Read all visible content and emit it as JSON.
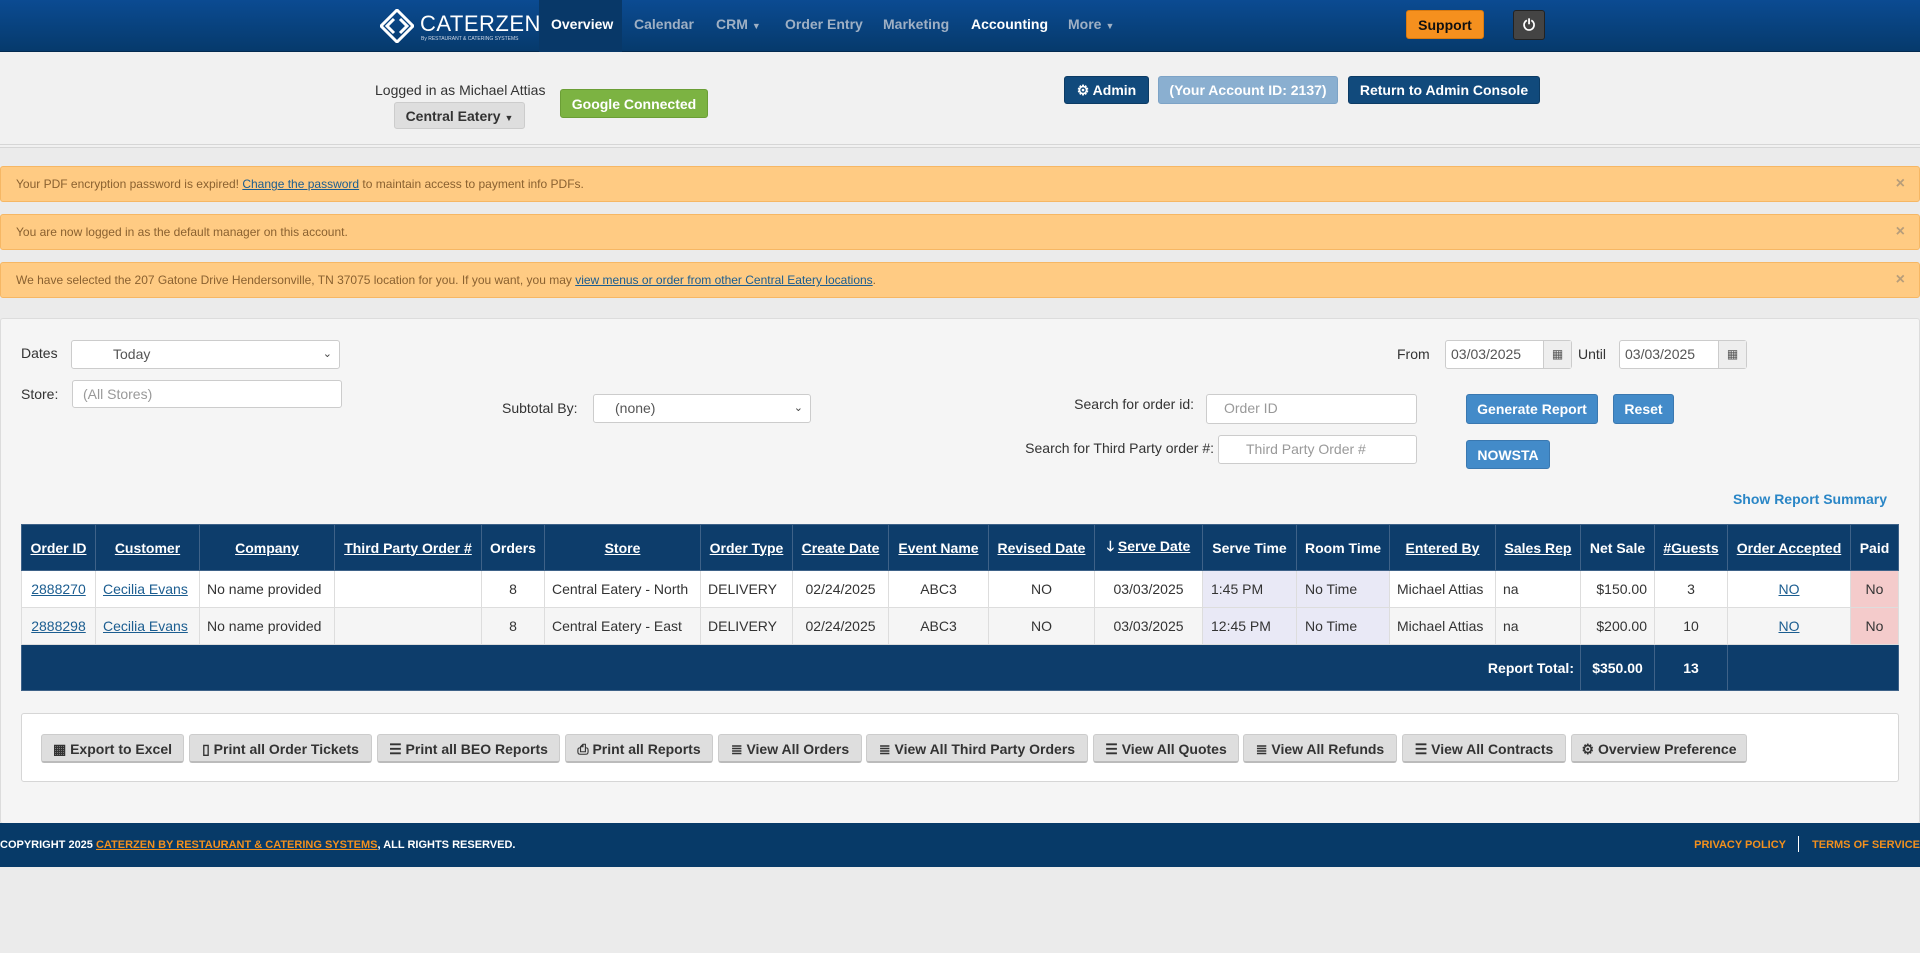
{
  "nav": {
    "brand": "CATERZEN",
    "brand_sub": "By RESTAURANT & CATERING SYSTEMS",
    "items": [
      {
        "label": "Overview"
      },
      {
        "label": "Calendar"
      },
      {
        "label": "CRM"
      },
      {
        "label": "Order Entry"
      },
      {
        "label": "Marketing"
      },
      {
        "label": "Accounting"
      },
      {
        "label": "More"
      }
    ],
    "support": "Support"
  },
  "header": {
    "logged_in": "Logged in as Michael Attias",
    "store_button": "Central Eatery",
    "google": "Google Connected",
    "admin": "Admin",
    "account_id": "(Your Account ID: 2137)",
    "return": "Return to Admin Console"
  },
  "alerts": [
    {
      "pre": "Your PDF encryption password is expired! ",
      "link": "Change the password",
      "post": " to maintain access to payment info PDFs."
    },
    {
      "pre": "You are now logged in as the default manager on this account.",
      "link": "",
      "post": ""
    },
    {
      "pre": "We have selected the 207 Gatone Drive Hendersonville, TN 37075 location for you. If you want, you may ",
      "link": "view menus or order from other Central Eatery locations",
      "post": "."
    }
  ],
  "filters": {
    "dates_label": "Dates",
    "dates_value": "Today",
    "store_label": "Store:",
    "store_placeholder": "(All Stores)",
    "subtotal_label": "Subtotal By:",
    "subtotal_value": "(none)",
    "from_label": "From",
    "from_value": "03/03/2025",
    "until_label": "Until",
    "until_value": "03/03/2025",
    "order_id_label": "Search for order id:",
    "order_id_placeholder": "Order ID",
    "third_party_label": "Search for Third Party order #:",
    "third_party_placeholder": "Third Party Order #",
    "generate": "Generate Report",
    "reset": "Reset",
    "nowsta": "NOWSTA",
    "summary": "Show Report Summary"
  },
  "table": {
    "columns": [
      "Order ID",
      "Customer",
      "Company",
      "Third Party Order #",
      "Orders",
      "Store",
      "Order Type",
      "Create Date",
      "Event Name",
      "Revised Date",
      "Serve Date",
      "Serve Time",
      "Room Time",
      "Entered By",
      "Sales Rep",
      "Net Sale",
      "#Guests",
      "Order Accepted",
      "Paid"
    ],
    "rows": [
      [
        "2888270",
        "Cecilia Evans",
        "No name provided",
        "",
        "8",
        "Central Eatery - North",
        "DELIVERY",
        "02/24/2025",
        "ABC3",
        "NO",
        "03/03/2025",
        "1:45 PM",
        "No Time",
        "Michael Attias",
        "na",
        "$150.00",
        "3",
        "NO",
        "No"
      ],
      [
        "2888298",
        "Cecilia Evans",
        "No name provided",
        "",
        "8",
        "Central Eatery - East",
        "DELIVERY",
        "02/24/2025",
        "ABC3",
        "NO",
        "03/03/2025",
        "12:45 PM",
        "No Time",
        "Michael Attias",
        "na",
        "$200.00",
        "10",
        "NO",
        "No"
      ]
    ],
    "total_label": "Report Total:",
    "total_net": "$350.00",
    "total_guests": "13"
  },
  "actions": [
    "Export to Excel",
    "Print all Order Tickets",
    "Print all BEO Reports",
    "Print all Reports",
    "View All Orders",
    "View All Third Party Orders",
    "View All Quotes",
    "View All Refunds",
    "View All Contracts",
    "Overview Preference"
  ],
  "footer": {
    "pre": "COPYRIGHT 2025 ",
    "link": "CATERZEN BY RESTAURANT & CATERING SYSTEMS",
    "post": ", ALL RIGHTS RESERVED.",
    "privacy": "PRIVACY POLICY",
    "terms": "TERMS OF SERVICE"
  },
  "colors": {
    "nav": "#0b4b92",
    "table_header": "#0d3d6b",
    "alert": "#ffcb83",
    "support": "#f5901e",
    "google": "#7cb342",
    "primary": "#438bc9"
  }
}
